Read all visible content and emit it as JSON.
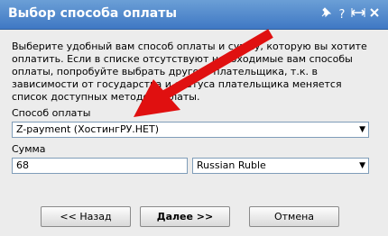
{
  "dialog": {
    "title": "Выбор способа оплаты",
    "icons": [
      "pin-icon",
      "help-icon",
      "resize-icon",
      "close-icon"
    ],
    "description": "Выберите удобный вам способ оплаты и сумму, которую вы хотите оплатить. Если в списке отсутствуют необходимые вам способы оплаты, попробуйте выбрать другого плательщика, т.к. в зависимости от государства и статуса плательщика меняется список доступных методов оплаты."
  },
  "form": {
    "method_label": "Способ оплаты",
    "method_value": "Z-payment (ХостингРУ.НЕТ)",
    "amount_label": "Сумма",
    "amount_value": "68",
    "currency_value": "Russian Ruble"
  },
  "buttons": {
    "back": "<< Назад",
    "next": "Далее >>",
    "cancel": "Отмена"
  },
  "colors": {
    "titlebar": "#3f78c4",
    "annotation_arrow": "#e01010"
  }
}
